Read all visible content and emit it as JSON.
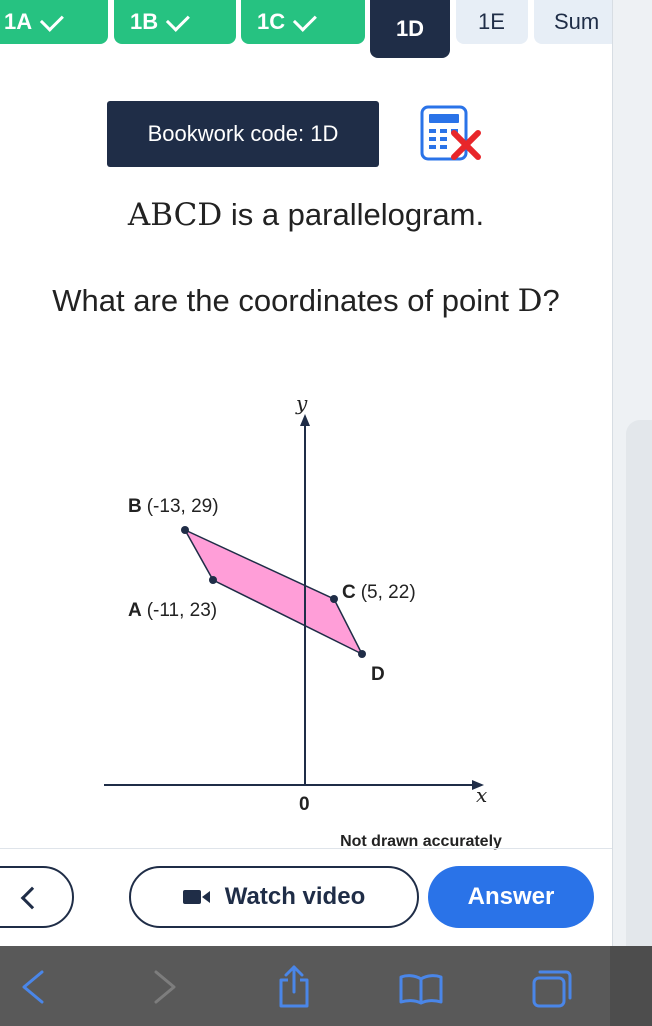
{
  "tabs": [
    {
      "label": "1A",
      "state": "done"
    },
    {
      "label": "1B",
      "state": "done"
    },
    {
      "label": "1C",
      "state": "done"
    },
    {
      "label": "1D",
      "state": "active"
    },
    {
      "label": "1E",
      "state": "todo"
    },
    {
      "label": "Sum",
      "state": "todo"
    }
  ],
  "bookwork": {
    "label": "Bookwork code: 1D"
  },
  "calculator_icon": {
    "name": "calculator-not-allowed-icon"
  },
  "question": {
    "line1_math": "ABCD",
    "line1_text": " is a parallelogram.",
    "line2_text": "What are the coordinates of point ",
    "line2_math": "D",
    "line2_end": "?"
  },
  "diagram": {
    "y_axis_label": "y",
    "x_axis_label": "x",
    "origin_label": "0",
    "points": [
      {
        "name": "B",
        "coords": "(-13, 29)"
      },
      {
        "name": "A",
        "coords": "(-11, 23)"
      },
      {
        "name": "C",
        "coords": "(5, 22)"
      },
      {
        "name": "D",
        "coords": ""
      }
    ],
    "note": "Not drawn accurately",
    "fill_color": "#ff9ed8"
  },
  "buttons": {
    "watch_video": "Watch video",
    "answer": "Answer"
  },
  "colors": {
    "done": "#26c281",
    "active": "#1f2d47",
    "todo": "#e7eef6",
    "primary": "#2a73e8"
  }
}
